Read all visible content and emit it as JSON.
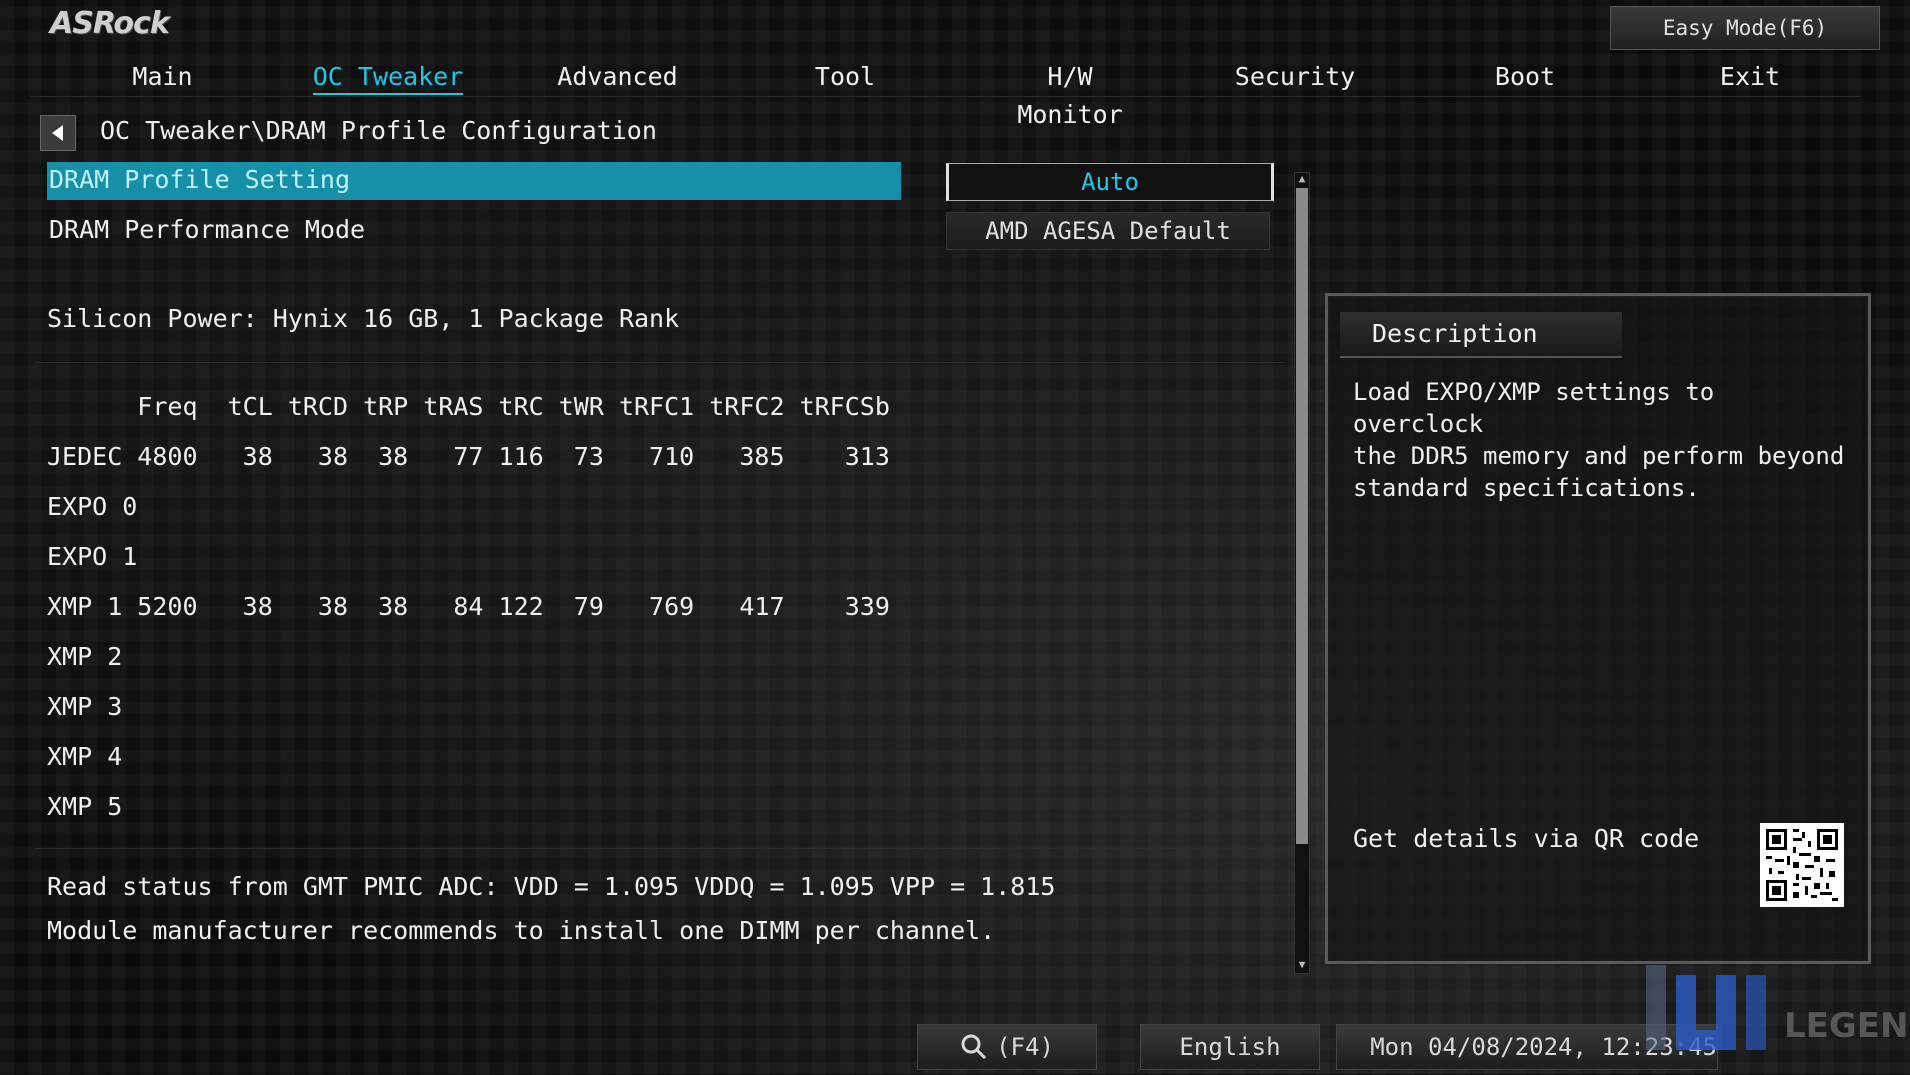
{
  "brand": "ASRock",
  "header": {
    "easy_mode": "Easy Mode(F6)"
  },
  "tabs": [
    {
      "label": "Main"
    },
    {
      "label": "OC Tweaker",
      "active": true
    },
    {
      "label": "Advanced"
    },
    {
      "label": "Tool"
    },
    {
      "label": "H/W Monitor"
    },
    {
      "label": "Security"
    },
    {
      "label": "Boot"
    },
    {
      "label": "Exit"
    }
  ],
  "breadcrumb": "OC Tweaker\\DRAM Profile Configuration",
  "settings": [
    {
      "label": "DRAM Profile Setting",
      "value": "Auto"
    },
    {
      "label": "DRAM Performance Mode",
      "value": "AMD AGESA Default"
    }
  ],
  "module_info": "Silicon Power: Hynix 16 GB, 1 Package Rank",
  "timings": {
    "header_row": "      Freq  tCL tRCD tRP tRAS tRC tWR tRFC1 tRFC2 tRFCSb",
    "rows": [
      "JEDEC 4800   38   38  38   77 116  73   710   385    313",
      "EXPO 0",
      "EXPO 1",
      "XMP 1 5200   38   38  38   84 122  79   769   417    339",
      "XMP 2",
      "XMP 3",
      "XMP 4",
      "XMP 5"
    ]
  },
  "status": {
    "line1": "Read status from GMT PMIC ADC: VDD = 1.095 VDDQ = 1.095 VPP = 1.815",
    "line2": "Module manufacturer recommends to install one DIMM per channel."
  },
  "description": {
    "title": "Description",
    "text": "Load EXPO/XMP settings to overclock\nthe DDR5 memory and perform beyond\nstandard specifications.",
    "qr_label": "Get details via QR code"
  },
  "footer": {
    "search_label": "(F4)",
    "language": "English",
    "datetime": "Mon 04/08/2024, 12:23:45"
  },
  "watermark": "LEGEND",
  "colors": {
    "accent": "#1ec8e8",
    "highlight": "#1690a8"
  }
}
